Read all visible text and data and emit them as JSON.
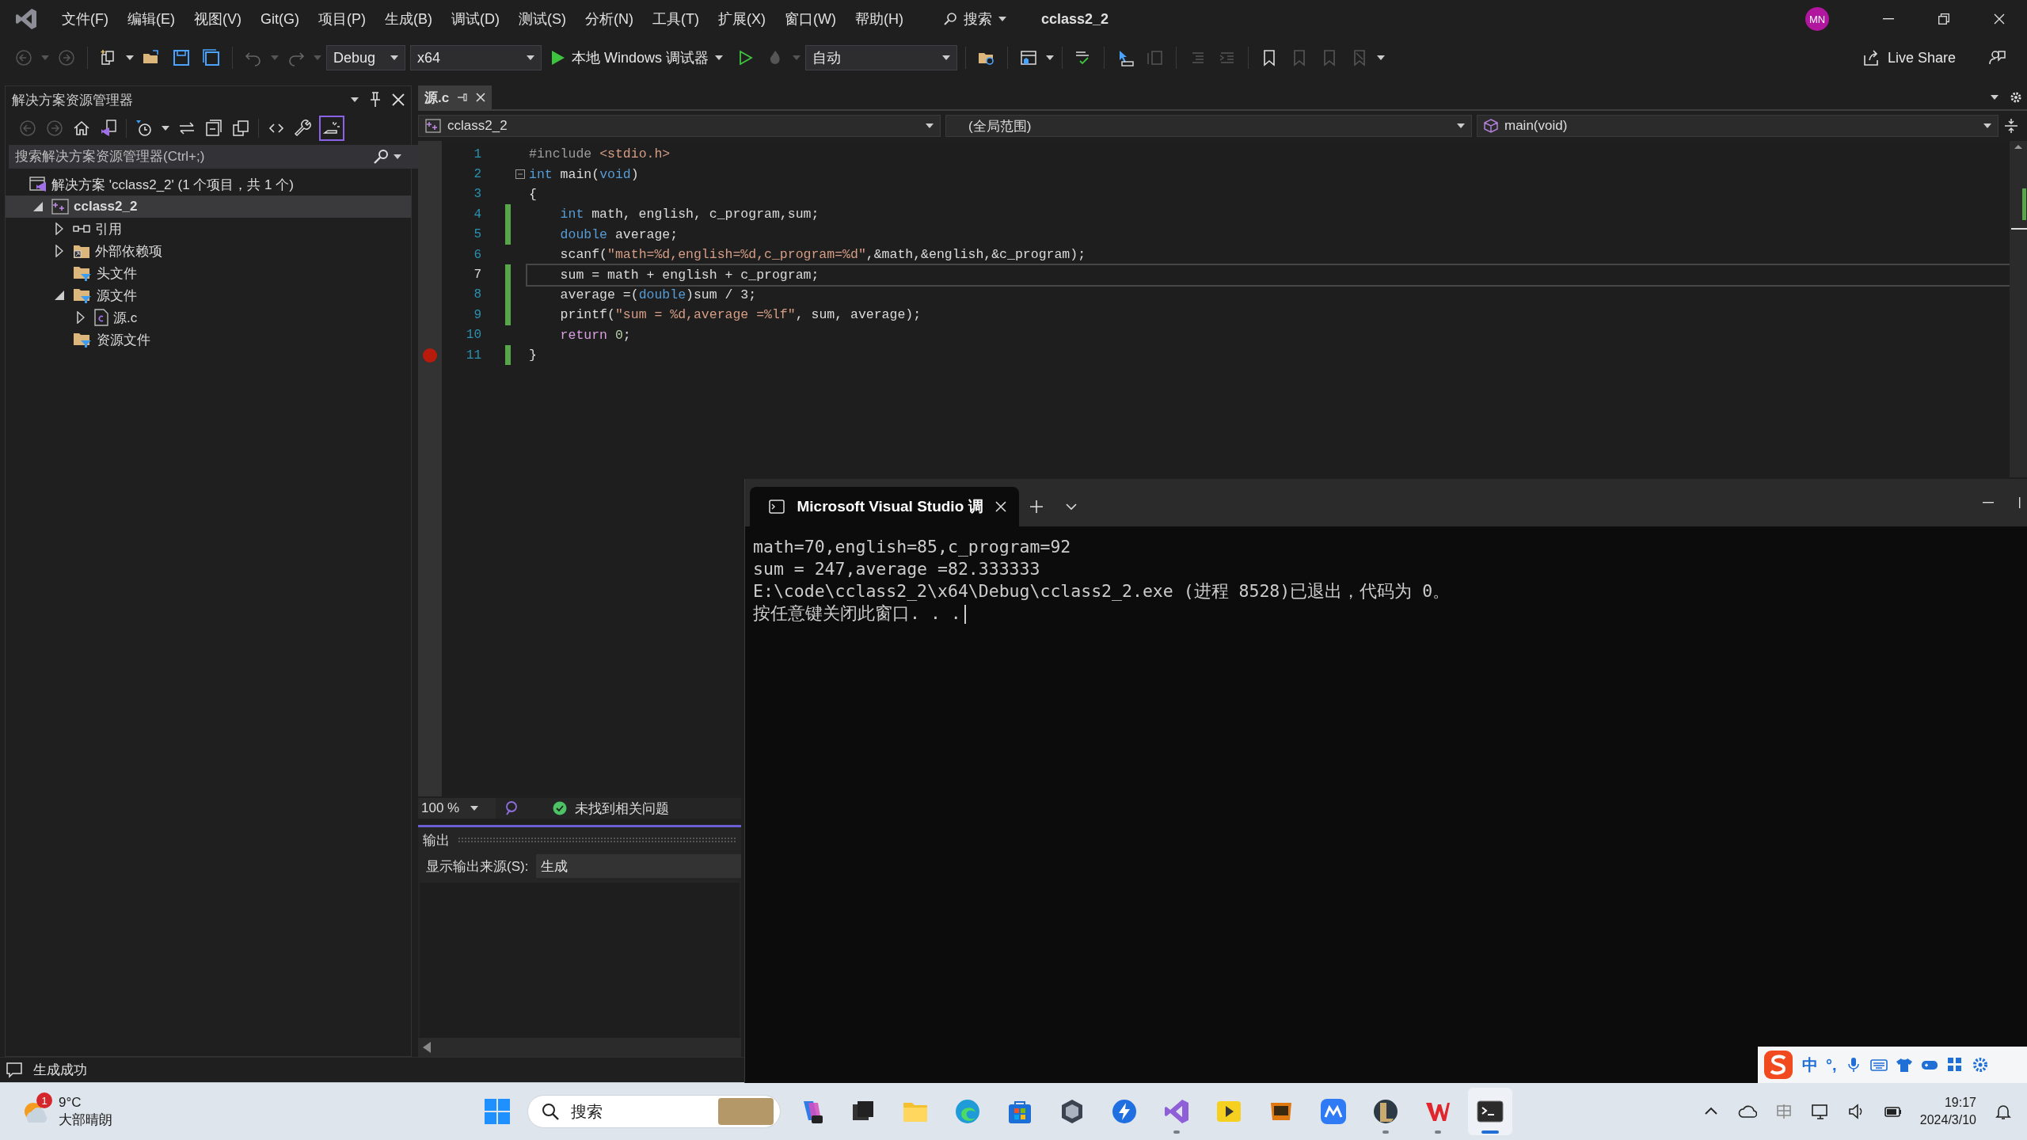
{
  "menu_bar": {
    "items": [
      "文件(F)",
      "编辑(E)",
      "视图(V)",
      "Git(G)",
      "项目(P)",
      "生成(B)",
      "调试(D)",
      "测试(S)",
      "分析(N)",
      "工具(T)",
      "扩展(X)",
      "窗口(W)",
      "帮助(H)"
    ],
    "search": "搜索",
    "solution_name": "cclass2_2",
    "avatar": "MN"
  },
  "toolbar": {
    "configuration": "Debug",
    "platform": "x64",
    "run_target": "本地 Windows 调试器",
    "scope": "自动",
    "live_share": "Live Share"
  },
  "solution_explorer": {
    "title": "解决方案资源管理器",
    "search_placeholder": "搜索解决方案资源管理器(Ctrl+;)",
    "tree": [
      {
        "label": "解决方案 'cclass2_2' (1 个项目，共 1 个)",
        "kind": "solution",
        "selected": false,
        "startup": false,
        "children": [
          {
            "label": "cclass2_2",
            "kind": "project",
            "expanded": true,
            "selected": true,
            "startup": true,
            "children": [
              {
                "label": "引用",
                "kind": "references",
                "expanded": false,
                "selected": false,
                "startup": false
              },
              {
                "label": "外部依赖项",
                "kind": "external",
                "expanded": false,
                "selected": false,
                "startup": false
              },
              {
                "label": "头文件",
                "kind": "filter",
                "selected": false,
                "startup": false
              },
              {
                "label": "源文件",
                "kind": "filter",
                "expanded": true,
                "selected": false,
                "startup": false,
                "children": [
                  {
                    "label": "源.c",
                    "kind": "cfile",
                    "expanded": false,
                    "selected": false,
                    "startup": false
                  }
                ]
              },
              {
                "label": "资源文件",
                "kind": "filter",
                "selected": false,
                "startup": false
              }
            ]
          }
        ]
      }
    ]
  },
  "editor": {
    "tabs": [
      {
        "label": "源.c",
        "selected": true
      }
    ],
    "nav": {
      "project": "cclass2_2",
      "scope": "(全局范围)",
      "member": "main(void)"
    },
    "lines": [
      {
        "n": "1",
        "changed": false,
        "breakpoint": false,
        "current": false,
        "fold": false,
        "tokens": [
          {
            "kind": "pre",
            "text": "#include "
          },
          {
            "kind": "str",
            "text": "<stdio.h>"
          }
        ]
      },
      {
        "n": "2",
        "changed": false,
        "breakpoint": false,
        "current": false,
        "fold": true,
        "tokens": [
          {
            "kind": "kw",
            "text": "int"
          },
          {
            "kind": "plain",
            "text": " main("
          },
          {
            "kind": "kw",
            "text": "void"
          },
          {
            "kind": "plain",
            "text": ")"
          }
        ]
      },
      {
        "n": "3",
        "changed": false,
        "breakpoint": false,
        "current": false,
        "fold": false,
        "tokens": [
          {
            "kind": "plain",
            "text": "{"
          }
        ]
      },
      {
        "n": "4",
        "changed": true,
        "breakpoint": false,
        "current": false,
        "fold": false,
        "tokens": [
          {
            "kind": "kw",
            "text": "    int"
          },
          {
            "kind": "plain",
            "text": " math, english, c_program,sum;"
          }
        ]
      },
      {
        "n": "5",
        "changed": true,
        "breakpoint": false,
        "current": false,
        "fold": false,
        "tokens": [
          {
            "kind": "kw",
            "text": "    double"
          },
          {
            "kind": "plain",
            "text": " average;"
          }
        ]
      },
      {
        "n": "6",
        "changed": false,
        "breakpoint": false,
        "current": false,
        "fold": false,
        "tokens": [
          {
            "kind": "plain",
            "text": "    scanf("
          },
          {
            "kind": "str",
            "text": "\"math=%d,english=%d,c_program=%d\""
          },
          {
            "kind": "plain",
            "text": ",&math,&english,&c_program);"
          }
        ]
      },
      {
        "n": "7",
        "changed": true,
        "breakpoint": false,
        "current": true,
        "fold": false,
        "tokens": [
          {
            "kind": "plain",
            "text": "    sum = math + english + c_program;"
          }
        ]
      },
      {
        "n": "8",
        "changed": true,
        "breakpoint": false,
        "current": false,
        "fold": false,
        "tokens": [
          {
            "kind": "plain",
            "text": "    average =("
          },
          {
            "kind": "kw",
            "text": "double"
          },
          {
            "kind": "plain",
            "text": ")sum / 3;"
          }
        ]
      },
      {
        "n": "9",
        "changed": true,
        "breakpoint": false,
        "current": false,
        "fold": false,
        "tokens": [
          {
            "kind": "plain",
            "text": "    printf("
          },
          {
            "kind": "str",
            "text": "\"sum = %d,average =%lf\""
          },
          {
            "kind": "plain",
            "text": ", sum, average);"
          }
        ]
      },
      {
        "n": "10",
        "changed": false,
        "breakpoint": false,
        "current": false,
        "fold": false,
        "tokens": [
          {
            "kind": "ctl",
            "text": "    return"
          },
          {
            "kind": "num",
            "text": " 0"
          },
          {
            "kind": "plain",
            "text": ";"
          }
        ]
      },
      {
        "n": "11",
        "changed": true,
        "breakpoint": true,
        "current": false,
        "fold": false,
        "tokens": [
          {
            "kind": "plain",
            "text": "}"
          }
        ]
      }
    ],
    "zoom": "100 %",
    "issues": "未找到相关问题"
  },
  "output": {
    "title": "输出",
    "source_label": "显示输出来源(S):",
    "source": "生成"
  },
  "status_bar": {
    "message": "生成成功"
  },
  "terminal": {
    "tab_title": "Microsoft Visual Studio 调",
    "lines": [
      "math=70,english=85,c_program=92",
      "sum = 247,average =82.333333",
      "E:\\code\\cclass2_2\\x64\\Debug\\cclass2_2.exe (进程 8528)已退出，代码为 0。",
      "按任意键关闭此窗口. . ."
    ]
  },
  "ime_bar": {
    "mode": "中",
    "punctuation": "°,"
  },
  "taskbar": {
    "weather": {
      "temperature": "9°C",
      "condition": "大部晴朗",
      "badge": "1"
    },
    "search": "搜索",
    "apps": [
      {
        "kind": "start",
        "running": false,
        "active": false
      },
      {
        "kind": "search"
      },
      {
        "kind": "copilot",
        "running": false,
        "active": false
      },
      {
        "kind": "taskview",
        "running": false,
        "active": false
      },
      {
        "kind": "explorer",
        "running": false,
        "active": false
      },
      {
        "kind": "edge",
        "running": false,
        "active": false
      },
      {
        "kind": "store",
        "running": false,
        "active": false
      },
      {
        "kind": "hexagon",
        "running": false,
        "active": false
      },
      {
        "kind": "bolt",
        "running": false,
        "active": false
      },
      {
        "kind": "vs",
        "running": true,
        "active": false
      },
      {
        "kind": "player",
        "running": false,
        "active": false
      },
      {
        "kind": "slides",
        "running": false,
        "active": false
      },
      {
        "kind": "cloud",
        "running": false,
        "active": false
      },
      {
        "kind": "league",
        "running": true,
        "active": false
      },
      {
        "kind": "wps",
        "running": true,
        "active": false
      },
      {
        "kind": "terminal",
        "running": true,
        "active": true
      }
    ],
    "time": "19:17",
    "date": "2024/3/10"
  }
}
